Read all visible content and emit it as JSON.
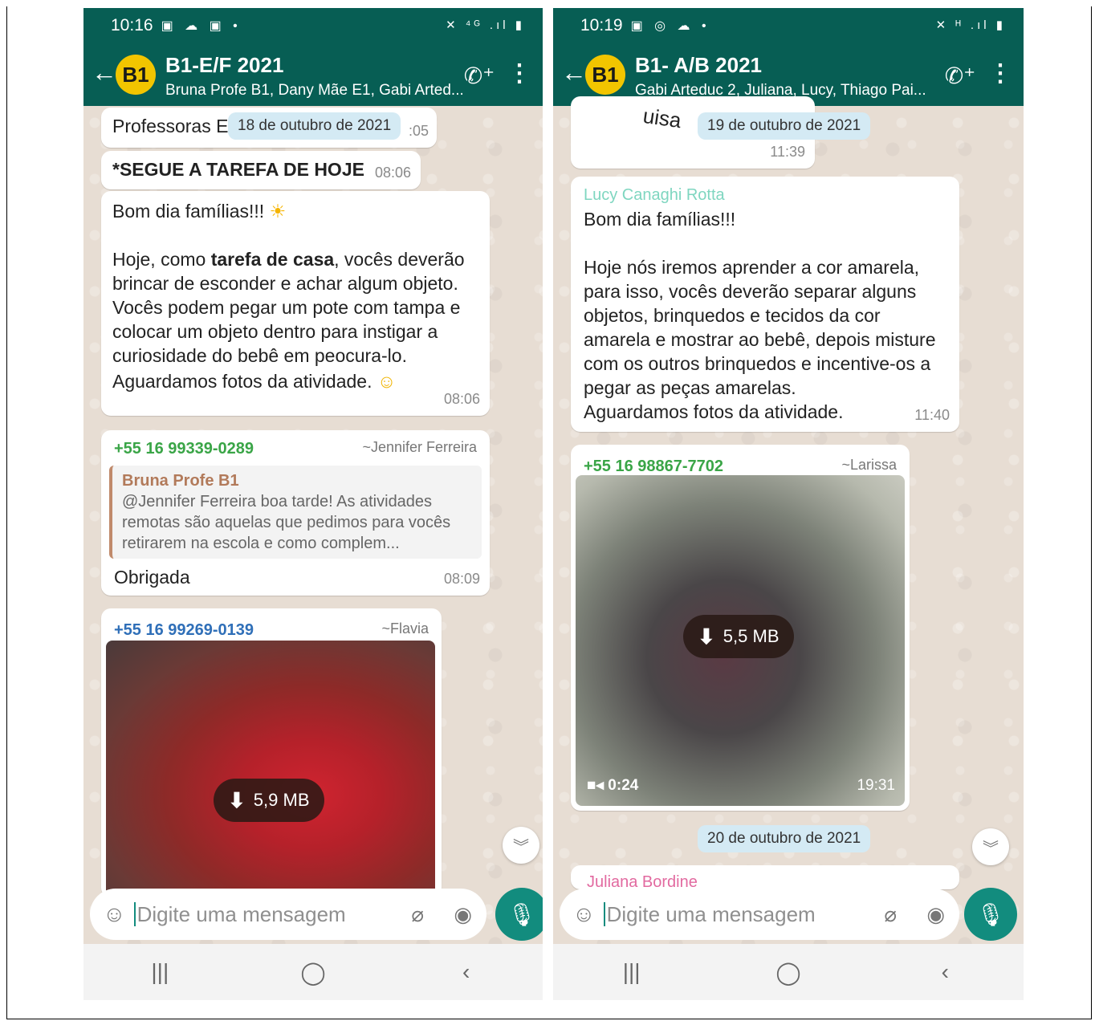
{
  "colors": {
    "header_green": "#075e54",
    "accent_teal": "#128c7e",
    "date_chip": "#d4eaf4"
  },
  "left": {
    "status": {
      "time": "10:16",
      "icons": "▣ ☁ ▣ •",
      "right_icons": "✕ ⁴ᴳ .ıl ▮"
    },
    "header": {
      "avatar_text": "B1",
      "title": "B1-E/F 2021",
      "subtitle": "Bruna Profe B1, Dany Mãe E1, Gabi Arted...",
      "call_icon": "add-call-icon",
      "menu_icon": "more-vert-icon"
    },
    "messages": {
      "m0_text": "Professoras E",
      "m0_time": ":05",
      "date_chip": "18 de outubro de 2021",
      "m1_text": "*SEGUE A TAREFA DE HOJE",
      "m1_time": "08:06",
      "m2_greeting": "Bom dia famílias!!!",
      "m2_pre": "Hoje, como ",
      "m2_bold": "tarefa de casa",
      "m2_post": ", vocês deverão brincar de esconder e achar algum objeto. Vocês podem pegar um pote com tampa e colocar um objeto dentro para instigar a curiosidade do bebê em peocura-lo.",
      "m2_last": "Aguardamos fotos da atividade.",
      "m2_time": "08:06",
      "m3_sender": "+55 16 99339-0289",
      "m3_alias": "~Jennifer Ferreira",
      "m3_quote_name": "Bruna Profe B1",
      "m3_quote_text": "@Jennifer Ferreira boa tarde! As atividades remotas são aquelas que pedimos para vocês retirarem na escola e como complem...",
      "m3_text": "Obrigada",
      "m3_time": "08:09",
      "m4_sender": "+55 16 99269-0139",
      "m4_alias": "~Flavia",
      "m4_size": "5,9 MB"
    },
    "input_placeholder": "Digite uma mensagem",
    "nav": {
      "recent": "|||",
      "home": "◯",
      "back": "‹"
    }
  },
  "right": {
    "status": {
      "time": "10:19",
      "icons": "▣ ◎ ☁ •",
      "right_icons": "✕ ᴴ .ıl ▮"
    },
    "header": {
      "avatar_text": "B1",
      "title": "B1- A/B 2021",
      "subtitle": "Gabi Arteduc 2, Juliana, Lucy, Thiago Pai...",
      "call_icon": "add-call-icon",
      "menu_icon": "more-vert-icon"
    },
    "messages": {
      "m0_partial": "uisa",
      "date_chip_1": "19 de outubro de 2021",
      "m0_time": "11:39",
      "m1_sender": "Lucy Canaghi Rotta",
      "m1_greeting": "Bom dia famílias!!!",
      "m1_body": "Hoje nós iremos aprender a cor amarela, para isso, vocês deverão separar alguns objetos, brinquedos e tecidos da cor amarela e mostrar ao bebê, depois misture com os outros brinquedos e incentive-os a pegar as peças amarelas.",
      "m1_last": "Aguardamos fotos da atividade.",
      "m1_time": "11:40",
      "m2_sender": "+55 16 98867-7702",
      "m2_alias": "~Larissa",
      "m2_size": "5,5 MB",
      "m2_duration": "0:24",
      "m2_time": "19:31",
      "date_chip_2": "20 de outubro de 2021",
      "m3_sender": "Juliana Bordine"
    },
    "input_placeholder": "Digite uma mensagem",
    "nav": {
      "recent": "|||",
      "home": "◯",
      "back": "‹"
    }
  }
}
